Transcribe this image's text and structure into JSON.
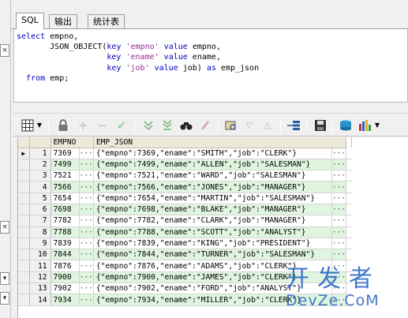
{
  "tabs": [
    {
      "label": "SQL",
      "active": true
    },
    {
      "label": "输出",
      "active": false
    },
    {
      "label": "统计表",
      "active": false
    }
  ],
  "sql": {
    "line1_kw": "select",
    "line1_rest": " empno,",
    "line2_fn": "JSON_OBJECT(",
    "line2_key": "key",
    "line2_str": "'empno'",
    "line2_val": "value",
    "line2_rest": " empno,",
    "line3_key": "key",
    "line3_str": "'ename'",
    "line3_val": "value",
    "line3_rest": " ename,",
    "line4_key": "key",
    "line4_str": "'job'",
    "line4_val": "value",
    "line4_rest": " job) ",
    "line4_as": "as",
    "line4_alias": " emp_json",
    "line5_kw": "from",
    "line5_rest": " emp;"
  },
  "toolbar": {
    "icons": [
      "grid-icon",
      "dropdown-arrow-icon",
      "lock-icon",
      "add-row-icon",
      "delete-row-icon",
      "post-changes-icon",
      "next-record-icon",
      "last-record-icon",
      "find-icon",
      "clear-icon",
      "query-by-example-icon",
      "filter-down-icon",
      "filter-up-icon",
      "single-record-view-icon",
      "save-icon",
      "export-icon",
      "chart-icon",
      "chart-dropdown-icon"
    ]
  },
  "grid": {
    "columns": [
      "EMPNO",
      "EMP_JSON"
    ],
    "ellipsis": "···",
    "current_marker": "▶",
    "rows": [
      {
        "n": "1",
        "empno": "7369",
        "json": "{\"empno\":7369,\"ename\":\"SMITH\",\"job\":\"CLERK\"}"
      },
      {
        "n": "2",
        "empno": "7499",
        "json": "{\"empno\":7499,\"ename\":\"ALLEN\",\"job\":\"SALESMAN\"}"
      },
      {
        "n": "3",
        "empno": "7521",
        "json": "{\"empno\":7521,\"ename\":\"WARD\",\"job\":\"SALESMAN\"}"
      },
      {
        "n": "4",
        "empno": "7566",
        "json": "{\"empno\":7566,\"ename\":\"JONES\",\"job\":\"MANAGER\"}"
      },
      {
        "n": "5",
        "empno": "7654",
        "json": "{\"empno\":7654,\"ename\":\"MARTIN\",\"job\":\"SALESMAN\"}"
      },
      {
        "n": "6",
        "empno": "7698",
        "json": "{\"empno\":7698,\"ename\":\"BLAKE\",\"job\":\"MANAGER\"}"
      },
      {
        "n": "7",
        "empno": "7782",
        "json": "{\"empno\":7782,\"ename\":\"CLARK\",\"job\":\"MANAGER\"}"
      },
      {
        "n": "8",
        "empno": "7788",
        "json": "{\"empno\":7788,\"ename\":\"SCOTT\",\"job\":\"ANALYST\"}"
      },
      {
        "n": "9",
        "empno": "7839",
        "json": "{\"empno\":7839,\"ename\":\"KING\",\"job\":\"PRESIDENT\"}"
      },
      {
        "n": "10",
        "empno": "7844",
        "json": "{\"empno\":7844,\"ename\":\"TURNER\",\"job\":\"SALESMAN\"}"
      },
      {
        "n": "11",
        "empno": "7876",
        "json": "{\"empno\":7876,\"ename\":\"ADAMS\",\"job\":\"CLERK\"}"
      },
      {
        "n": "12",
        "empno": "7900",
        "json": "{\"empno\":7900,\"ename\":\"JAMES\",\"job\":\"CLERK\"}"
      },
      {
        "n": "13",
        "empno": "7902",
        "json": "{\"empno\":7902,\"ename\":\"FORD\",\"job\":\"ANALYST\"}"
      },
      {
        "n": "14",
        "empno": "7934",
        "json": "{\"empno\":7934,\"ename\":\"MILLER\",\"job\":\"CLERK\"}"
      }
    ]
  },
  "left_strip": {
    "close_glyph": "×"
  },
  "watermark": {
    "line1": "开发者",
    "line2": "DevZe.CoM"
  },
  "colors": {
    "keyword": "#0000c0",
    "string": "#9a2a9a",
    "even_row": "#dff5df",
    "watermark": "#2a66c8"
  }
}
